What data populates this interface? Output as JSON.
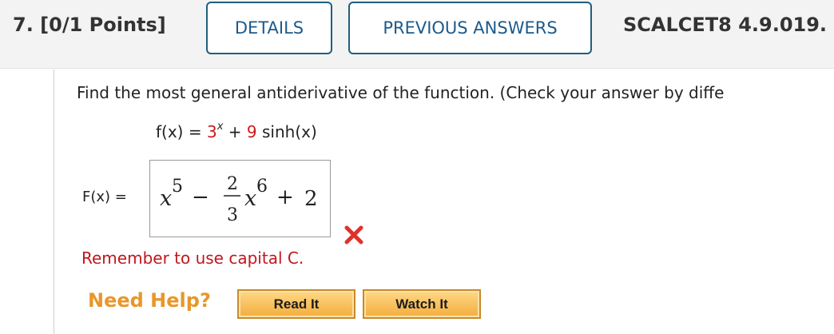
{
  "question": {
    "number_points": "7. [0/1 Points]",
    "details_label": "DETAILS",
    "previous_answers_label": "PREVIOUS ANSWERS",
    "code": "SCALCET8 4.9.019."
  },
  "problem": {
    "prompt": "Find the most general antiderivative of the function. (Check your answer by diffe",
    "function": {
      "lhs": "f(x)",
      "equals": "=",
      "base": "3",
      "exponent": "x",
      "plus": "+",
      "coefficient": "9",
      "term": "sinh(x)"
    }
  },
  "answer": {
    "label": "F(x)",
    "equals": "=",
    "x1": "x",
    "e1": "5",
    "minus": "−",
    "num": "2",
    "den": "3",
    "x2": "x",
    "e2": "6",
    "plus": "+",
    "const": "2",
    "status_icon": "incorrect-x-icon",
    "feedback": "Remember to use capital C."
  },
  "help": {
    "label": "Need Help?",
    "read_it_label": "Read It",
    "watch_it_label": "Watch It"
  },
  "colors": {
    "accent_blue": "#1d5a8c",
    "error_red": "#cc1b1b",
    "help_orange": "#e8962a"
  }
}
